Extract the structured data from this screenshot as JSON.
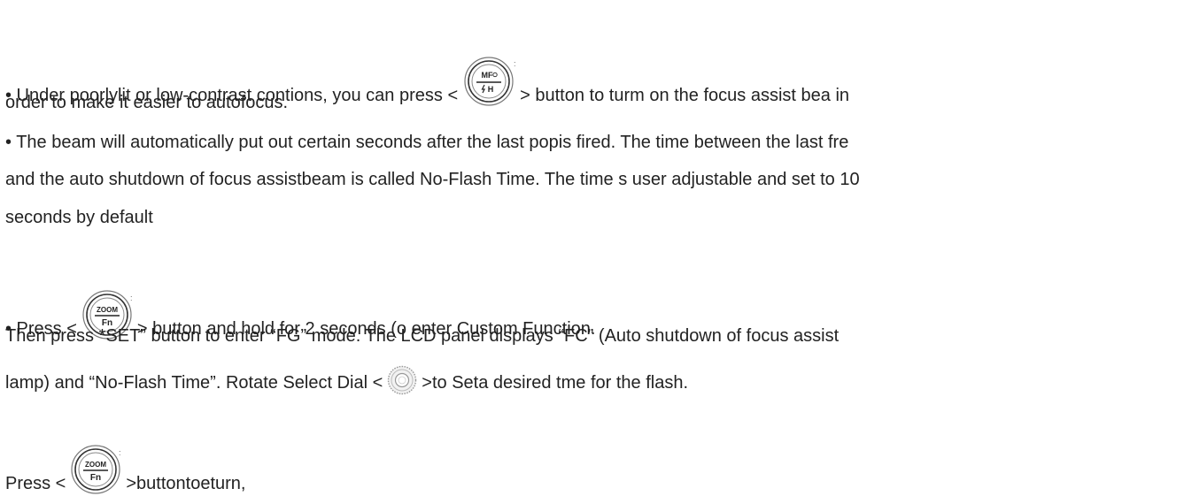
{
  "paragraphs": {
    "p1": {
      "prefix": "• Under poorlylit or low-contrast contions, you can press <",
      "icon": "mf-flash-h-button-icon",
      "icon_top": "MF",
      "icon_bottom": "H",
      "suffix": "> button to turm on the focus assist bea in",
      "line2": "order to make it easier to autofocus."
    },
    "p2": {
      "line1": "• The beam will automatically put out certain seconds after the last popis fired. The time between the last fre",
      "line2": "and the auto shutdown of focus assistbeam is called No-Flash Time. The time s user adjustable and set to 10",
      "line3": "seconds by default"
    },
    "p3": {
      "prefix": "• Press <",
      "icon": "zoom-fn-button-icon",
      "icon_top": "ZOOM",
      "icon_bottom": "Fn",
      "suffix": "> button and hold for 2 seconds (o enter Custom Function."
    },
    "p4": {
      "line1": "Then press *SET” button to enter “FG” mode. The LCD panel displays “FC” (Auto shutdown of focus assist",
      "prefix": "lamp) and “No-Flash Time”. Rotate Select Dial <",
      "icon": "select-dial-icon",
      "suffix": ">to Seta desired tme for the flash."
    },
    "p5": {
      "prefix": "Press <",
      "icon": "zoom-fn-button-icon",
      "icon_top": "ZOOM",
      "icon_bottom": "Fn",
      "suffix": ">buttontoeturn,"
    }
  }
}
